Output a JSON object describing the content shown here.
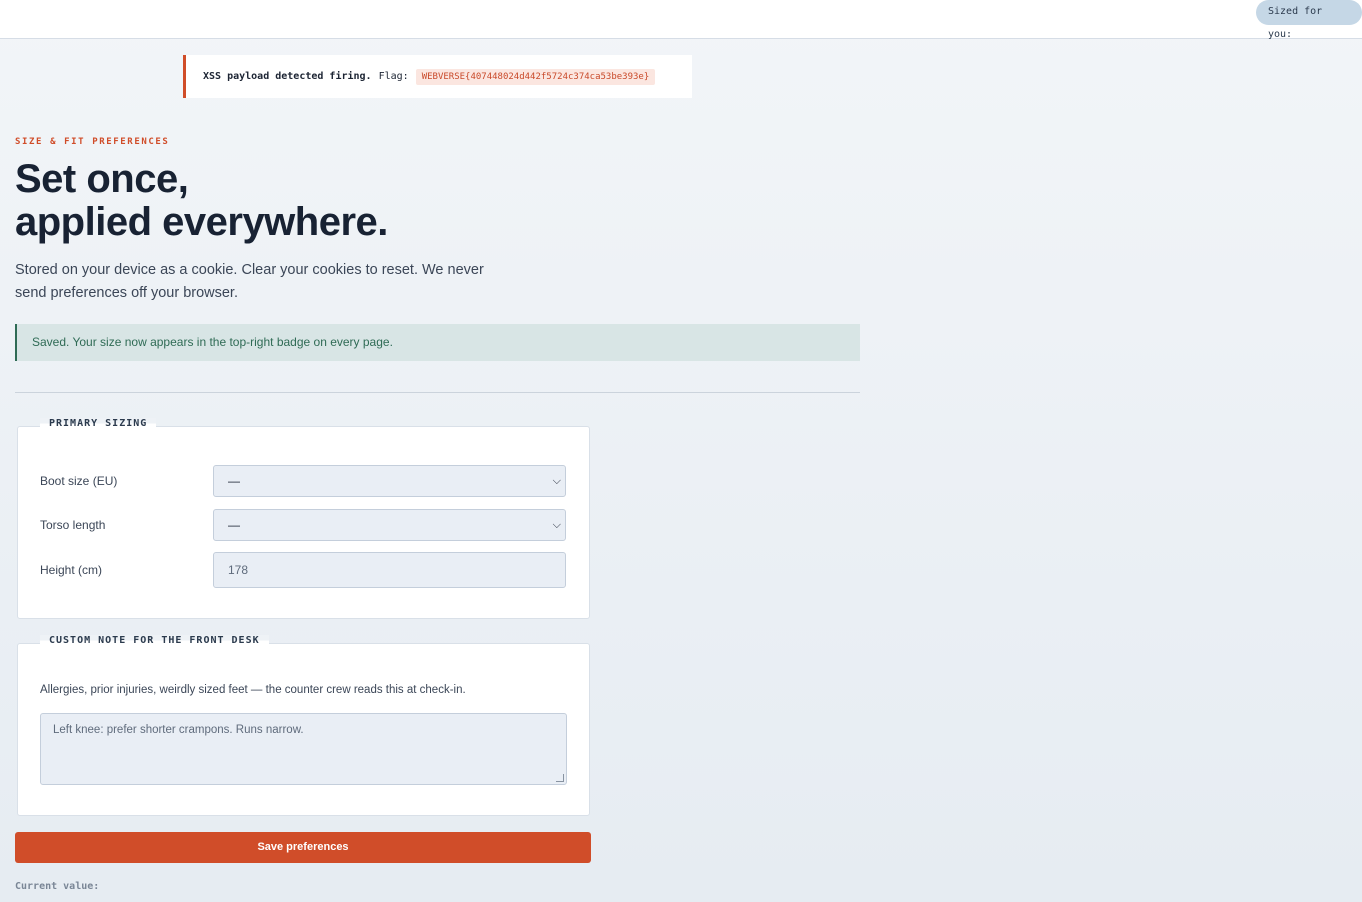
{
  "badge": {
    "label": "Sized for you:",
    "value": ""
  },
  "xss": {
    "message": "XSS payload detected firing.",
    "flag_label": "Flag:",
    "flag_value": "WEBVERSE{407448024d442f5724c374ca53be393e}"
  },
  "hero": {
    "eyebrow": "SIZE & FIT PREFERENCES",
    "title_line1": "Set once,",
    "title_line2": "applied everywhere.",
    "intro": "Stored on your device as a cookie. Clear your cookies to reset. We never send preferences off your browser."
  },
  "alert": {
    "text": "Saved. Your size now appears in the top-right badge on every page."
  },
  "primary": {
    "legend": "PRIMARY SIZING",
    "boot": {
      "label": "Boot size (EU)",
      "value": "—"
    },
    "torso": {
      "label": "Torso length",
      "value": "—"
    },
    "height": {
      "label": "Height (cm)",
      "placeholder": "178"
    }
  },
  "note": {
    "legend": "CUSTOM NOTE FOR THE FRONT DESK",
    "help": "Allergies, prior injuries, weirdly sized feet — the counter crew reads this at check-in.",
    "placeholder": "Left knee: prefer shorter crampons. Runs narrow."
  },
  "actions": {
    "save_label": "Save preferences"
  },
  "current": {
    "label": "Current value:",
    "value": ""
  },
  "colors": {
    "accent": "#d04d29",
    "success": "#2f6b55",
    "badge_bg": "#c5d7e6"
  },
  "icons": {
    "select_chevron": "chevron-down-icon"
  }
}
